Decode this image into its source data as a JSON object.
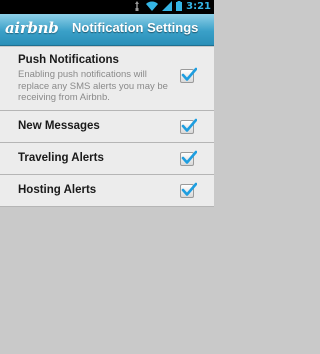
{
  "status_bar": {
    "time": "3:21",
    "icons": [
      "usb-icon",
      "wifi-icon",
      "signal-icon",
      "battery-icon"
    ],
    "time_color": "#35b5e5"
  },
  "app_bar": {
    "logo_text": "airbnb",
    "title": "Notification Settings",
    "background": "#3aa0c8"
  },
  "settings": {
    "push": {
      "label": "Push Notifications",
      "description": "Enabling push notifications will replace any SMS alerts you may be receiving from Airbnb.",
      "checked": true
    },
    "new_messages": {
      "label": "New Messages",
      "checked": true
    },
    "traveling_alerts": {
      "label": "Traveling Alerts",
      "checked": true
    },
    "hosting_alerts": {
      "label": "Hosting Alerts",
      "checked": true
    }
  },
  "colors": {
    "check": "#1e9ee0",
    "row_background": "#ececec",
    "page_background": "#c9c9c9"
  }
}
